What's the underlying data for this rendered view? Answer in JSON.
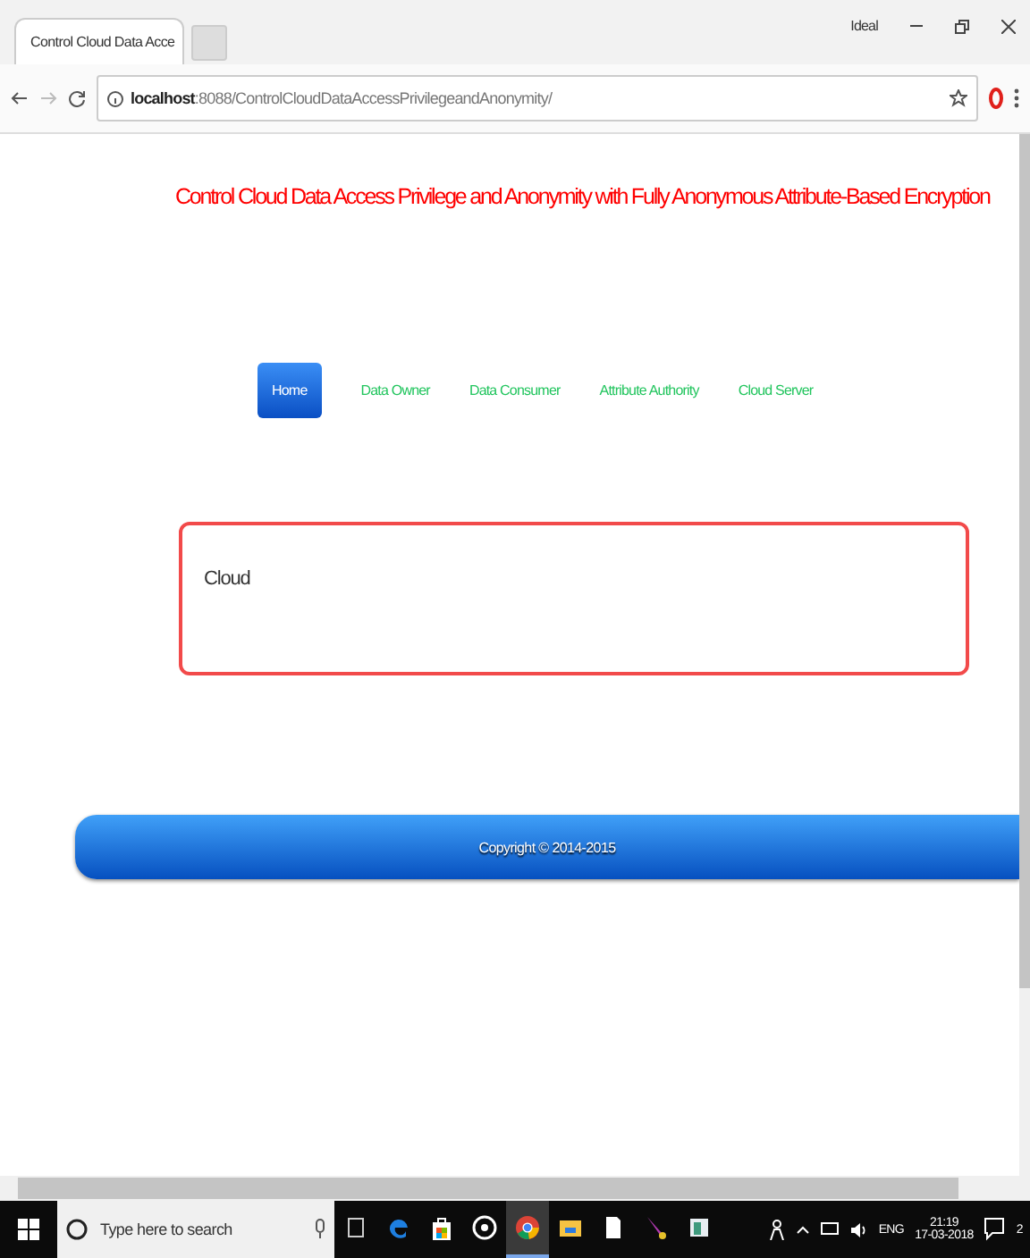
{
  "browser": {
    "tab_title": "Control Cloud Data Acce",
    "profile": "Ideal",
    "url_host": "localhost",
    "url_rest": ":8088/ControlCloudDataAccessPrivilegeandAnonymity/"
  },
  "page": {
    "title": "Control Cloud Data Access Privilege and Anonymity with Fully Anonymous Attribute-Based Encryption",
    "nav": [
      {
        "label": "Home",
        "selected": true
      },
      {
        "label": "Data Owner",
        "selected": false
      },
      {
        "label": "Data Consumer",
        "selected": false
      },
      {
        "label": "Attribute Authority",
        "selected": false
      },
      {
        "label": "Cloud Server",
        "selected": false
      }
    ],
    "content": "Cloud",
    "footer": "Copyright © 2014-2015"
  },
  "taskbar": {
    "search_placeholder": "Type here to search",
    "apps": [
      {
        "kind": "taskview",
        "active": false
      },
      {
        "kind": "edge",
        "active": false
      },
      {
        "kind": "store",
        "active": false
      },
      {
        "kind": "media",
        "active": false
      },
      {
        "kind": "chrome",
        "active": true
      },
      {
        "kind": "explorer",
        "active": false
      },
      {
        "kind": "file",
        "active": false
      },
      {
        "kind": "paint",
        "active": false
      },
      {
        "kind": "app",
        "active": false
      }
    ],
    "language": "ENG",
    "time": "21:19",
    "date": "17-03-2018",
    "notifications": "2"
  }
}
